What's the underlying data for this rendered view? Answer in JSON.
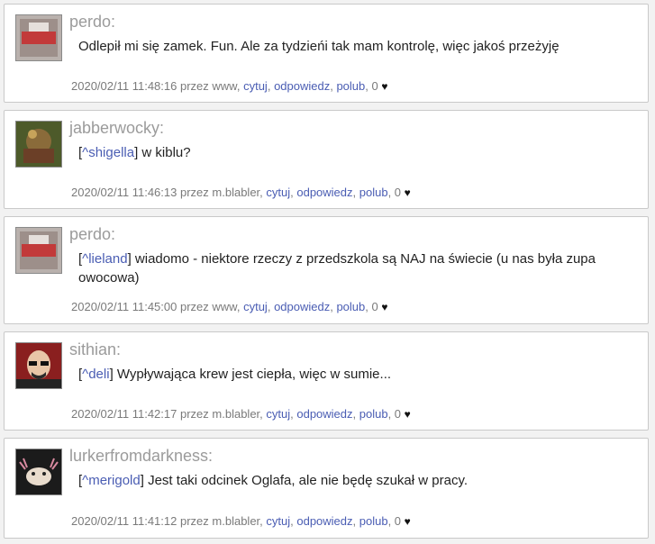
{
  "posts": [
    {
      "author": "perdo:",
      "reply_to": "",
      "text": "Odlepił mi się zamek. Fun. Ale za tydzieńi tak mam kontrolę, więc jakoś przeżyję",
      "date": "2020/02/11 11:48:16",
      "by_label": "przez",
      "user": "www",
      "actions": [
        "cytuj",
        "odpowiedz",
        "polub"
      ],
      "likes": "0",
      "heart": "♥"
    },
    {
      "author": "jabberwocky:",
      "reply_to": "^shigella",
      "text": "w kiblu?",
      "date": "2020/02/11 11:46:13",
      "by_label": "przez",
      "user": "m.blabler",
      "actions": [
        "cytuj",
        "odpowiedz",
        "polub"
      ],
      "likes": "0",
      "heart": "♥"
    },
    {
      "author": "perdo:",
      "reply_to": "^lieland",
      "text": "wiadomo - niektore rzeczy z przedszkola są NAJ na świecie (u nas była zupa owocowa)",
      "date": "2020/02/11 11:45:00",
      "by_label": "przez",
      "user": "www",
      "actions": [
        "cytuj",
        "odpowiedz",
        "polub"
      ],
      "likes": "0",
      "heart": "♥"
    },
    {
      "author": "sithian:",
      "reply_to": "^deli",
      "text": "Wypływająca krew jest ciepła, więc w sumie...",
      "date": "2020/02/11 11:42:17",
      "by_label": "przez",
      "user": "m.blabler",
      "actions": [
        "cytuj",
        "odpowiedz",
        "polub"
      ],
      "likes": "0",
      "heart": "♥"
    },
    {
      "author": "lurkerfromdarkness:",
      "reply_to": "^merigold",
      "text": "Jest taki odcinek Oglafa, ale nie będę szukał w pracy.",
      "date": "2020/02/11 11:41:12",
      "by_label": "przez",
      "user": "m.blabler",
      "actions": [
        "cytuj",
        "odpowiedz",
        "polub"
      ],
      "likes": "0",
      "heart": "♥"
    }
  ]
}
